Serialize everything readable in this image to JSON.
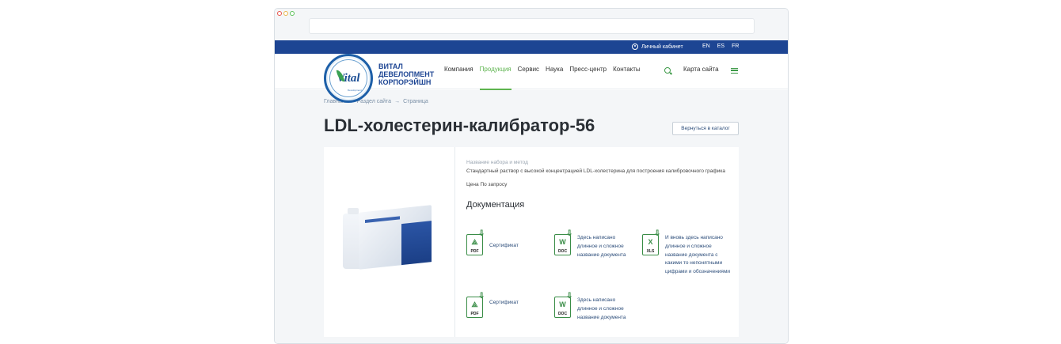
{
  "topbar": {
    "cabinet_label": "Личный кабинет",
    "languages": [
      "EN",
      "ES",
      "FR"
    ]
  },
  "header": {
    "logo_text": "Vital",
    "logo_sub": "Development",
    "company_name": [
      "ВИТАЛ",
      "ДЕВЕЛОПМЕНТ",
      "КОРПОРЭЙШН"
    ],
    "nav": [
      "Компания",
      "Продукция",
      "Сервис",
      "Наука",
      "Пресс-центр",
      "Контакты"
    ],
    "active_nav": "Продукция",
    "sitemap": "Карта сайта"
  },
  "breadcrumb": [
    "Главная",
    "Раздел сайта",
    "Страница"
  ],
  "breadcrumb_sep": "→",
  "page_title": "LDL-холестерин-калибратор-56",
  "back_button": "Вернуться в каталог",
  "product": {
    "set_label": "Название набора и метод",
    "description": "Стандартный раствор с высокой концентрацией LDL-холестерина для построения калибровочного графика",
    "price_label": "Цена",
    "price_value": "По запросу"
  },
  "documents": {
    "title": "Документация",
    "items": [
      {
        "type": "PDF",
        "text": "Сертификат"
      },
      {
        "type": "DOC",
        "text": "Здесь написано длинное и сложное название документа"
      },
      {
        "type": "XLS",
        "text": "И вновь здесь написано длинное и сложное название документа с какими то непонятными цифрами и обозначениями"
      },
      {
        "type": "PDF",
        "text": "Сертификат"
      },
      {
        "type": "DOC",
        "text": "Здесь написано длинное и сложное название документа"
      }
    ]
  },
  "colors": {
    "topbar": "#1d4593",
    "accent_green": "#5eb44f",
    "icon_green": "#3a8d47"
  }
}
